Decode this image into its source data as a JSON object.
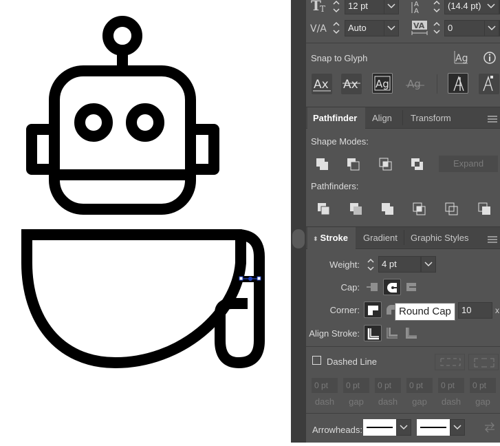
{
  "character": {
    "font_size": "12 pt",
    "leading": "(14.4 pt)",
    "kerning": "Auto",
    "tracking": "0"
  },
  "snap_to_glyph": {
    "label": "Snap to Glyph"
  },
  "pathfinder_panel": {
    "tabs": [
      "Pathfinder",
      "Align",
      "Transform"
    ],
    "shape_modes_label": "Shape Modes:",
    "expand_label": "Expand",
    "pathfinders_label": "Pathfinders:"
  },
  "stroke_panel": {
    "tabs": [
      "Stroke",
      "Gradient",
      "Graphic Styles"
    ],
    "weight_label": "Weight:",
    "weight_value": "4 pt",
    "cap_label": "Cap:",
    "corner_label": "Corner:",
    "miter_value": "10",
    "miter_unit": "x",
    "align_label": "Align Stroke:",
    "dashed_line_label": "Dashed Line",
    "dash_fields": [
      {
        "value": "0 pt",
        "label": "dash"
      },
      {
        "value": "0 pt",
        "label": "gap"
      },
      {
        "value": "0 pt",
        "label": "dash"
      },
      {
        "value": "0 pt",
        "label": "gap"
      },
      {
        "value": "0 pt",
        "label": "dash"
      },
      {
        "value": "0 pt",
        "label": "gap"
      }
    ],
    "arrowheads_label": "Arrowheads:"
  },
  "tooltip": {
    "text": "Round Cap"
  },
  "colors": {
    "panel_bg": "#535353",
    "canvas_bg": "#ffffff",
    "selection": "#1f3fbf"
  }
}
